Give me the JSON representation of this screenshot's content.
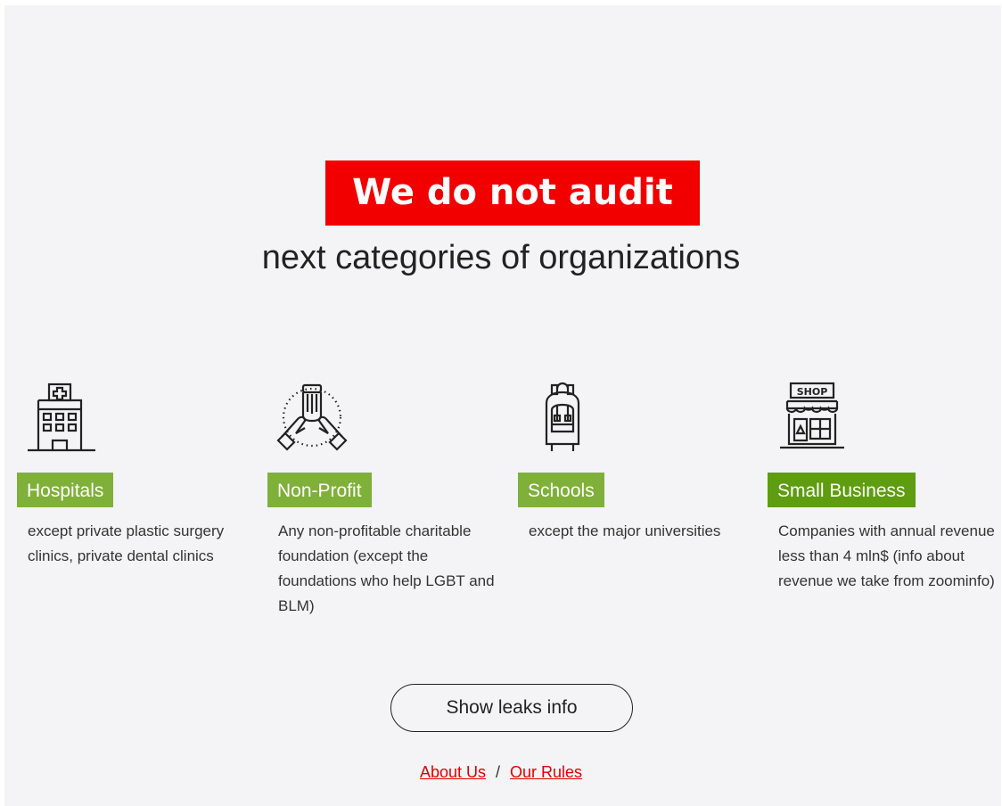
{
  "hero": {
    "badge": "We do not audit",
    "subtitle": "next categories of organizations"
  },
  "categories": [
    {
      "icon": "hospital-icon",
      "label": "Hospitals",
      "description": "except private plastic surgery clinics, private dental clinics",
      "color": "#7fb03a"
    },
    {
      "icon": "charity-hands-icon",
      "label": "Non-Profit",
      "description": "Any non-profitable charitable foundation (except the foundations who help LGBT and BLM)",
      "color": "#7fb03a"
    },
    {
      "icon": "backpack-icon",
      "label": "Schools",
      "description": "except the major universities",
      "color": "#7fb03a"
    },
    {
      "icon": "shop-icon",
      "label": "Small Business",
      "description": "Companies with annual revenue less than 4 mln$ (info about revenue we take from zoominfo)",
      "color": "#5e9c10"
    }
  ],
  "button": {
    "label": "Show leaks info"
  },
  "footer": {
    "about": "About Us",
    "separator": "/",
    "rules": "Our Rules"
  },
  "colors": {
    "badge_bg": "#f20000",
    "link": "#e00000",
    "background": "#f4f4f6"
  }
}
